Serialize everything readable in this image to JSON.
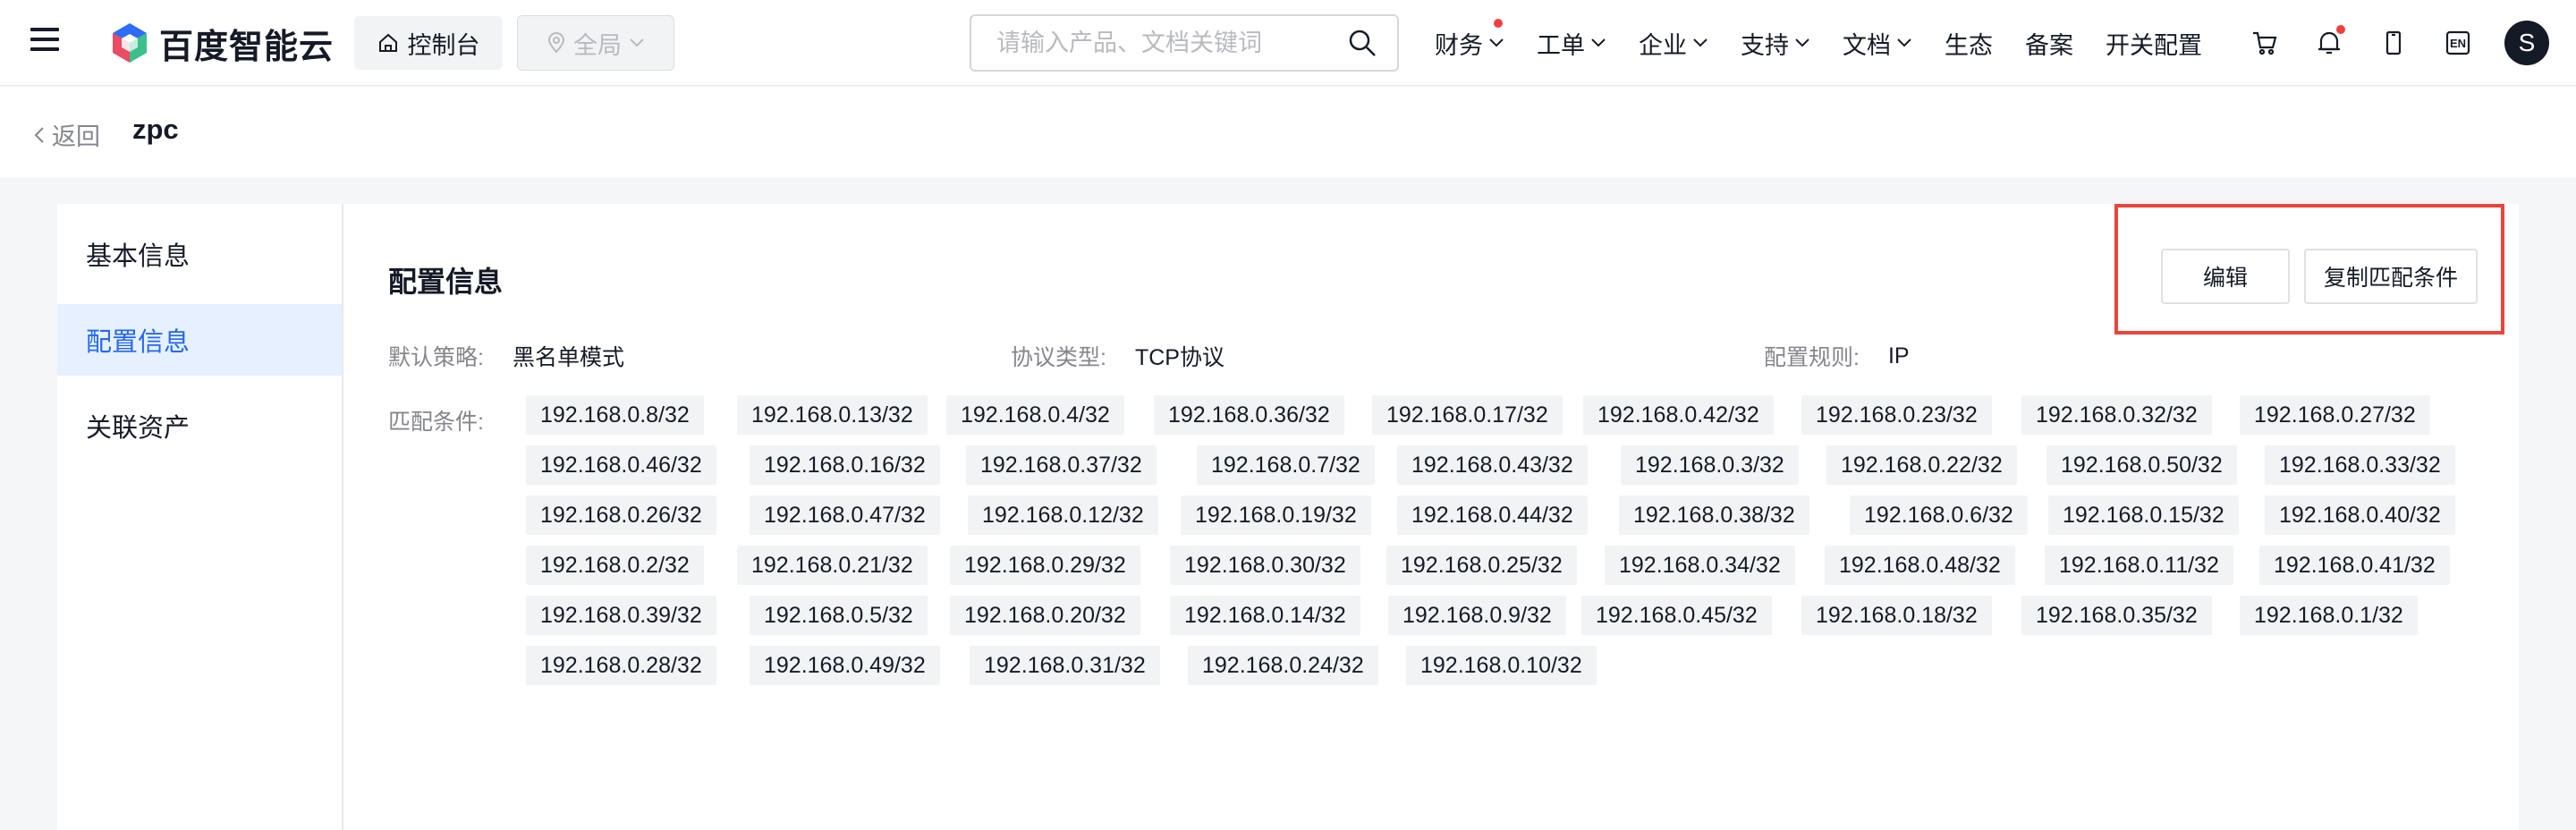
{
  "header": {
    "logo_text": "百度智能云",
    "console_label": "控制台",
    "region_label": "全局",
    "search_placeholder": "请输入产品、文档关键词",
    "nav": [
      {
        "label": "财务",
        "has_dot": true,
        "has_chevron": true
      },
      {
        "label": "工单",
        "has_dot": false,
        "has_chevron": true
      },
      {
        "label": "企业",
        "has_dot": false,
        "has_chevron": true
      },
      {
        "label": "支持",
        "has_dot": false,
        "has_chevron": true
      },
      {
        "label": "文档",
        "has_dot": false,
        "has_chevron": true
      },
      {
        "label": "生态",
        "has_dot": false,
        "has_chevron": false
      },
      {
        "label": "备案",
        "has_dot": false,
        "has_chevron": false
      },
      {
        "label": "开关配置",
        "has_dot": false,
        "has_chevron": false
      }
    ],
    "icons": [
      "cart-icon",
      "bell-icon",
      "mobile-icon",
      "language-icon"
    ],
    "language_label": "EN",
    "avatar_initial": "S"
  },
  "subheader": {
    "back_label": "返回",
    "title": "zpc"
  },
  "sidebar": {
    "items": [
      {
        "label": "基本信息",
        "active": false
      },
      {
        "label": "配置信息",
        "active": true
      },
      {
        "label": "关联资产",
        "active": false
      }
    ]
  },
  "main": {
    "section_title": "配置信息",
    "edit_label": "编辑",
    "copy_label": "复制匹配条件",
    "info": [
      {
        "label": "默认策略:",
        "value": "黑名单模式"
      },
      {
        "label": "协议类型:",
        "value": "TCP协议"
      },
      {
        "label": "配置规则:",
        "value": "IP"
      }
    ],
    "match_label": "匹配条件:",
    "match_rows": [
      [
        "192.168.0.8/32",
        "192.168.0.13/32",
        "192.168.0.4/32",
        "192.168.0.36/32",
        "192.168.0.17/32",
        "192.168.0.42/32",
        "192.168.0.23/32",
        "192.168.0.32/32",
        "192.168.0.27/32"
      ],
      [
        "192.168.0.46/32",
        "192.168.0.16/32",
        "192.168.0.37/32",
        "192.168.0.7/32",
        "192.168.0.43/32",
        "192.168.0.3/32",
        "192.168.0.22/32",
        "192.168.0.50/32",
        "192.168.0.33/32"
      ],
      [
        "192.168.0.26/32",
        "192.168.0.47/32",
        "192.168.0.12/32",
        "192.168.0.19/32",
        "192.168.0.44/32",
        "192.168.0.38/32",
        "192.168.0.6/32",
        "192.168.0.15/32",
        "192.168.0.40/32"
      ],
      [
        "192.168.0.2/32",
        "192.168.0.21/32",
        "192.168.0.29/32",
        "192.168.0.30/32",
        "192.168.0.25/32",
        "192.168.0.34/32",
        "192.168.0.48/32",
        "192.168.0.11/32",
        "192.168.0.41/32"
      ],
      [
        "192.168.0.39/32",
        "192.168.0.5/32",
        "192.168.0.20/32",
        "192.168.0.14/32",
        "192.168.0.9/32",
        "192.168.0.45/32",
        "192.168.0.18/32",
        "192.168.0.35/32",
        "192.168.0.1/32"
      ],
      [
        "192.168.0.28/32",
        "192.168.0.49/32",
        "192.168.0.31/32",
        "192.168.0.24/32",
        "192.168.0.10/32"
      ]
    ]
  },
  "colors": {
    "accent": "#2468f2",
    "active_bg": "#e6f0ff",
    "highlight_border": "#e8453c",
    "notification_dot": "#f33e3e"
  }
}
